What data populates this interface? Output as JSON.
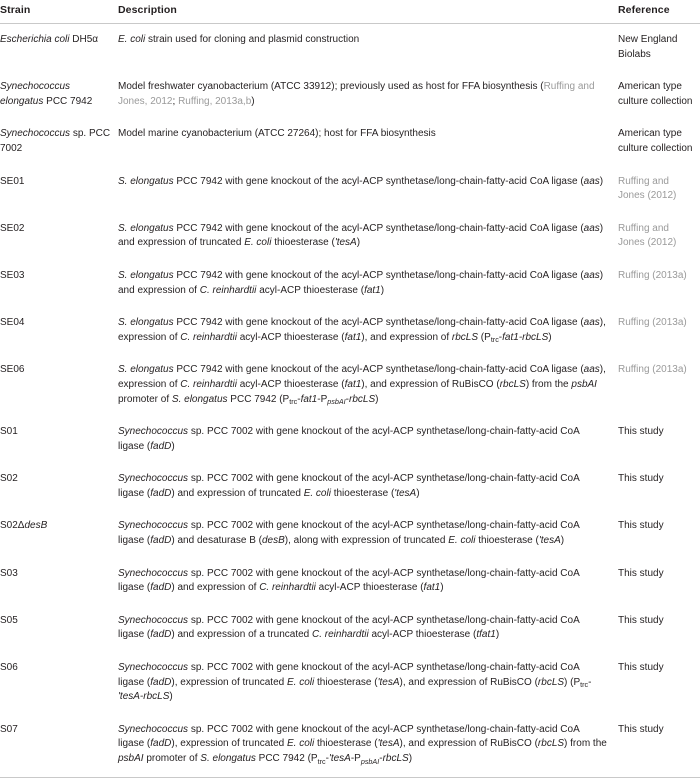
{
  "table": {
    "columns": [
      "Strain",
      "Description",
      "Reference"
    ],
    "rows": [
      {
        "strain_html": "<span class=\"it\">Escherichia coli</span> DH5α",
        "description_html": "<span class=\"it\">E. coli</span> strain used for cloning and plasmid construction",
        "reference_html": "New England Biolabs",
        "reference_is_link": false
      },
      {
        "strain_html": "<span class=\"it\">Synechococcus elongatus</span> PCC 7942",
        "description_html": "Model freshwater cyanobacterium (ATCC 33912); previously used as host for FFA biosynthesis (<span class=\"cite\">Ruffing and Jones, 2012</span>; <span class=\"cite\">Ruffing, 2013a,b</span>)",
        "reference_html": "American type culture collection",
        "reference_is_link": false
      },
      {
        "strain_html": "<span class=\"it\">Synechococcus</span> sp. PCC 7002",
        "description_html": "Model marine cyanobacterium (ATCC 27264); host for FFA biosynthesis",
        "reference_html": "American type culture collection",
        "reference_is_link": false
      },
      {
        "strain_html": "SE01",
        "description_html": "<span class=\"it\">S. elongatus</span> PCC 7942 with gene knockout of the acyl-ACP synthetase/long-chain-fatty-acid CoA ligase (<span class=\"it\">aas</span>)",
        "reference_html": "Ruffing and Jones (2012)",
        "reference_is_link": true
      },
      {
        "strain_html": "SE02",
        "description_html": "<span class=\"it\">S. elongatus</span> PCC 7942 with gene knockout of the acyl-ACP synthetase/long-chain-fatty-acid CoA ligase (<span class=\"it\">aas</span>) and expression of truncated <span class=\"it\">E. coli</span> thioesterase (<span class=\"it\">'tesA</span>)",
        "reference_html": "Ruffing and Jones (2012)",
        "reference_is_link": true
      },
      {
        "strain_html": "SE03",
        "description_html": "<span class=\"it\">S. elongatus</span> PCC 7942 with gene knockout of the acyl-ACP synthetase/long-chain-fatty-acid CoA ligase (<span class=\"it\">aas</span>) and expression of <span class=\"it\">C. reinhardtii</span> acyl-ACP thioesterase (<span class=\"it\">fat1</span>)",
        "reference_html": "Ruffing (2013a)",
        "reference_is_link": true
      },
      {
        "strain_html": "SE04",
        "description_html": "<span class=\"it\">S. elongatus</span> PCC 7942 with gene knockout of the acyl-ACP synthetase/long-chain-fatty-acid CoA ligase (<span class=\"it\">aas</span>), expression of <span class=\"it\">C. reinhardtii</span> acyl-ACP thioesterase (<span class=\"it\">fat1</span>), and expression of <span class=\"it\">rbcLS</span> (P<sub class=\"roman\">trc</sub>-<span class=\"it\">fat1-rbcLS</span>)",
        "reference_html": "Ruffing (2013a)",
        "reference_is_link": true
      },
      {
        "strain_html": "SE06",
        "description_html": "<span class=\"it\">S. elongatus</span> PCC 7942 with gene knockout of the acyl-ACP synthetase/long-chain-fatty-acid CoA ligase (<span class=\"it\">aas</span>), expression of <span class=\"it\">C. reinhardtii</span> acyl-ACP thioesterase (<span class=\"it\">fat1</span>), and expression of RuBisCO (<span class=\"it\">rbcLS</span>) from the <span class=\"it\">psbAI</span> promoter of <span class=\"it\">S. elongatus</span> PCC 7942 (P<sub class=\"roman\">trc</sub>-<span class=\"it\">fat1</span>-P<sub>psbAI</sub>-<span class=\"it\">rbcLS</span>)",
        "reference_html": "Ruffing (2013a)",
        "reference_is_link": true
      },
      {
        "strain_html": "S01",
        "description_html": "<span class=\"it\">Synechococcus</span> sp. PCC 7002 with gene knockout of the acyl-ACP synthetase/long-chain-fatty-acid CoA ligase (<span class=\"it\">fadD</span>)",
        "reference_html": "This study",
        "reference_is_link": false
      },
      {
        "strain_html": "S02",
        "description_html": "<span class=\"it\">Synechococcus</span> sp. PCC 7002 with gene knockout of the acyl-ACP synthetase/long-chain-fatty-acid CoA ligase (<span class=\"it\">fadD</span>) and expression of truncated <span class=\"it\">E. coli</span> thioesterase (<span class=\"it\">'tesA</span>)",
        "reference_html": "This study",
        "reference_is_link": false
      },
      {
        "strain_html": "S02Δ<span class=\"it\">desB</span>",
        "description_html": "<span class=\"it\">Synechococcus</span> sp. PCC 7002 with gene knockout of the acyl-ACP synthetase/long-chain-fatty-acid CoA ligase (<span class=\"it\">fadD</span>) and desaturase B (<span class=\"it\">desB</span>), along with expression of truncated <span class=\"it\">E. coli</span> thioesterase (<span class=\"it\">'tesA</span>)",
        "reference_html": "This study",
        "reference_is_link": false
      },
      {
        "strain_html": "S03",
        "description_html": "<span class=\"it\">Synechococcus</span> sp. PCC 7002 with gene knockout of the acyl-ACP synthetase/long-chain-fatty-acid CoA ligase (<span class=\"it\">fadD</span>) and expression of <span class=\"it\">C. reinhardtii</span> acyl-ACP thioesterase (<span class=\"it\">fat1</span>)",
        "reference_html": "This study",
        "reference_is_link": false
      },
      {
        "strain_html": "S05",
        "description_html": "<span class=\"it\">Synechococcus</span> sp. PCC 7002 with gene knockout of the acyl-ACP synthetase/long-chain-fatty-acid CoA ligase (<span class=\"it\">fadD</span>) and expression of a truncated <span class=\"it\">C. reinhardtii</span> acyl-ACP thioesterase (<span class=\"it\">tfat1</span>)",
        "reference_html": "This study",
        "reference_is_link": false
      },
      {
        "strain_html": "S06",
        "description_html": "<span class=\"it\">Synechococcus</span> sp. PCC 7002 with gene knockout of the acyl-ACP synthetase/long-chain-fatty-acid CoA ligase (<span class=\"it\">fadD</span>), expression of truncated <span class=\"it\">E. coli</span> thioesterase (<span class=\"it\">'tesA</span>), and expression of RuBisCO (<span class=\"it\">rbcLS</span>) (P<sub class=\"roman\">trc</sub>-<span class=\"it\">'tesA-rbcLS</span>)",
        "reference_html": "This study",
        "reference_is_link": false
      },
      {
        "strain_html": "S07",
        "description_html": "<span class=\"it\">Synechococcus</span> sp. PCC 7002 with gene knockout of the acyl-ACP synthetase/long-chain-fatty-acid CoA ligase (<span class=\"it\">fadD</span>), expression of truncated <span class=\"it\">E. coli</span> thioesterase (<span class=\"it\">'tesA</span>), and expression of RuBisCO (<span class=\"it\">rbcLS</span>) from the <span class=\"it\">psbAI</span> promoter of <span class=\"it\">S. elongatus</span> PCC 7942 (P<sub class=\"roman\">trc</sub>-<span class=\"it\">'tesA</span>-P<sub>psbAI</sub>-<span class=\"it\">rbcLS</span>)",
        "reference_html": "This study",
        "reference_is_link": false
      }
    ]
  },
  "colors": {
    "text": "#231f20",
    "citation_link": "#9a9a9a",
    "rule": "#c9c9c9",
    "background": "#ffffff"
  }
}
